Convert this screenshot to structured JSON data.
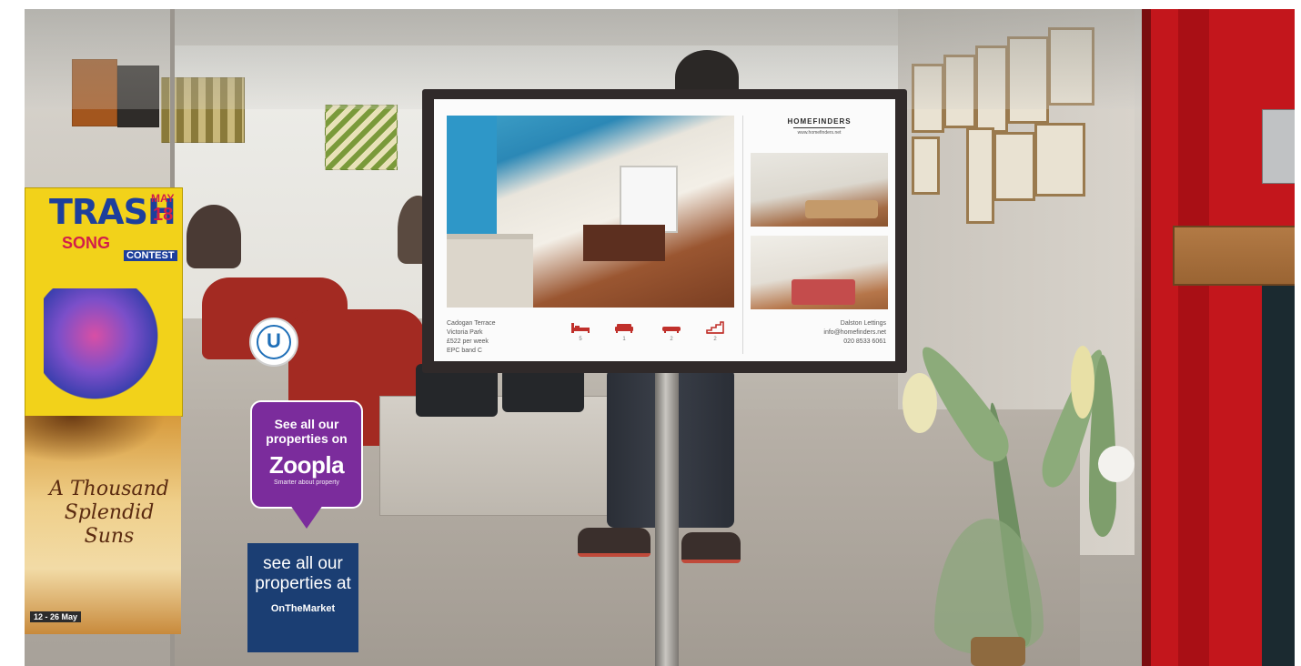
{
  "display": {
    "brand": "HOMEFINDERS",
    "brand_url": "www.homefinders.net",
    "address_lines": [
      "Cadogan Terrace",
      "Victoria Park",
      "£522 per week",
      "EPC band C"
    ],
    "features": [
      {
        "icon": "bed-icon",
        "count": "5"
      },
      {
        "icon": "sofa-icon",
        "count": "1"
      },
      {
        "icon": "bath-icon",
        "count": "2"
      },
      {
        "icon": "stairs-icon",
        "count": "2"
      }
    ],
    "contact_lines": [
      "Dalston Lettings",
      "info@homefinders.net",
      "020 8533 6061"
    ],
    "accent_color": "#c0302b"
  },
  "posters": {
    "trash": {
      "title": "TRASH",
      "month": "MAY",
      "day": "18",
      "line1": "SONG",
      "line2": "CONTEST",
      "colors": {
        "background": "#f2d21a",
        "primary": "#1d3f9c",
        "accent": "#d21e4a"
      }
    },
    "book": {
      "title": "A Thousand Splendid Suns",
      "footer": "12 - 26 May"
    }
  },
  "stickers": {
    "u_badge": "U",
    "zoopla": {
      "line1": "See all our properties on",
      "brand": "Zoopla",
      "tagline": "Smarter about property",
      "color": "#7b2c9c"
    },
    "onthemarket": {
      "text": "see all our properties at",
      "brand": "OnTheMarket",
      "color": "#1b3e73"
    }
  },
  "door": {
    "color": "#c3161c"
  }
}
